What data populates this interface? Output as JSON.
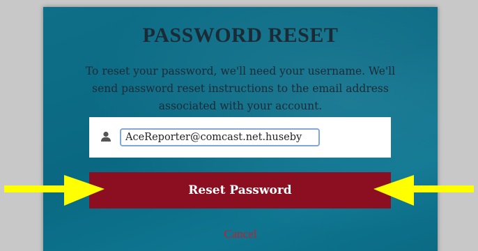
{
  "dialog": {
    "title": "PASSWORD RESET",
    "description": "To reset your password, we'll need your username. We'll send password reset instructions to the email address associated with your account."
  },
  "username": {
    "icon": "user-icon",
    "value": "AceReporter@comcast.net.huseby"
  },
  "reset_button": {
    "label": "Reset Password",
    "color": "#8b0f20"
  },
  "cancel": {
    "label": "Cancel",
    "color": "#c0202e"
  },
  "annotations": {
    "arrow_color": "#ffff00",
    "arrow_left_icon": "arrow-right-icon",
    "arrow_right_icon": "arrow-left-icon"
  },
  "colors": {
    "panel": "#0a6882",
    "page_background": "#c8c8c8"
  }
}
